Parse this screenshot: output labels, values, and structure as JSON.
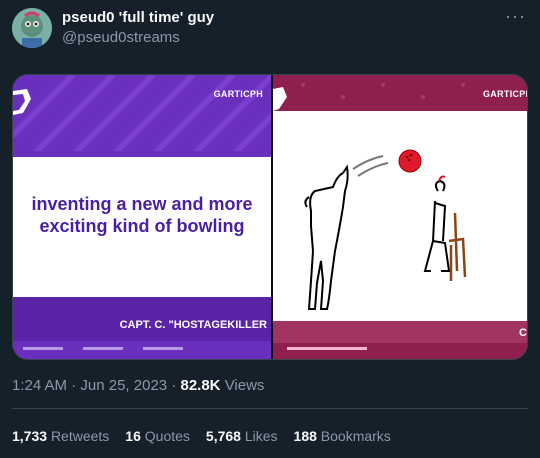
{
  "author": {
    "name": "pseud0 'full time' guy",
    "handle": "@pseud0streams"
  },
  "media": {
    "left": {
      "logo_text": "GARTICPH",
      "prompt": "inventing a new and more exciting kind of bowling",
      "player_name": "CAPT. C. \"HOSTAGEKILLER"
    },
    "right": {
      "logo_text": "GARTICPH",
      "player_name": "C"
    }
  },
  "meta": {
    "time": "1:24 AM",
    "date": "Jun 25, 2023",
    "views_count": "82.8K",
    "views_label": "Views"
  },
  "stats": {
    "retweets_count": "1,733",
    "retweets_label": "Retweets",
    "quotes_count": "16",
    "quotes_label": "Quotes",
    "likes_count": "5,768",
    "likes_label": "Likes",
    "bookmarks_count": "188",
    "bookmarks_label": "Bookmarks"
  },
  "colors": {
    "background": "#15202b",
    "text_primary": "#f7f9f9",
    "text_secondary": "#8b98a5",
    "left_panel": "#6b2fbe",
    "right_panel": "#8e1f4e",
    "bowling_ball": "#e0182b"
  },
  "icons": {
    "more": "more-horizontal-icon"
  }
}
